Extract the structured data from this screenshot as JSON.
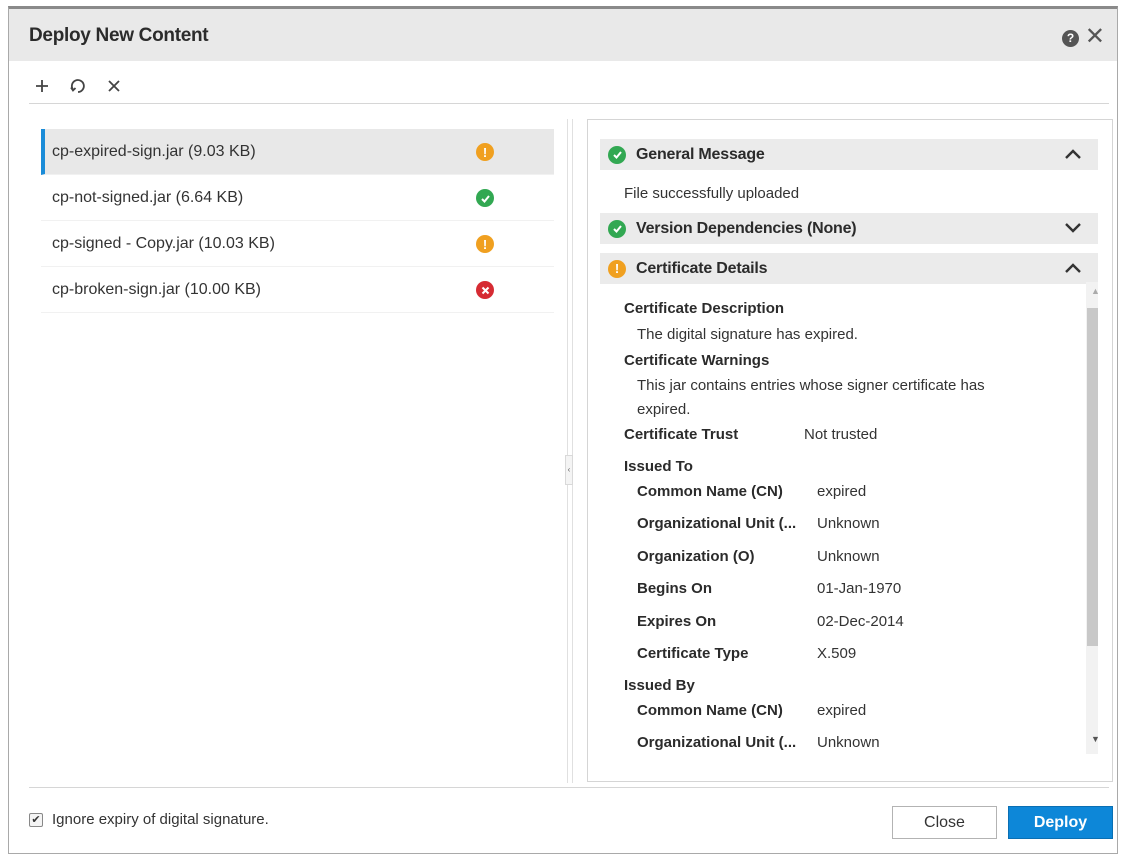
{
  "dialog": {
    "title": "Deploy New Content",
    "help_label": "?",
    "close_glyph": "✕"
  },
  "toolbar": {
    "add_icon": "plus-icon",
    "refresh_icon": "refresh-icon",
    "remove_icon": "close-icon"
  },
  "files": [
    {
      "label": "cp-expired-sign.jar (9.03 KB)",
      "status": "warning",
      "selected": true
    },
    {
      "label": "cp-not-signed.jar (6.64 KB)",
      "status": "success",
      "selected": false
    },
    {
      "label": "cp-signed - Copy.jar (10.03 KB)",
      "status": "warning",
      "selected": false
    },
    {
      "label": "cp-broken-sign.jar (10.00 KB)",
      "status": "error",
      "selected": false
    }
  ],
  "status_glyphs": {
    "warning": "!",
    "success": "✓",
    "error": "✕"
  },
  "colors": {
    "warning": "#f0a020",
    "success": "#32a852",
    "error": "#d62b33",
    "accent": "#0d87d8",
    "selection_bar": "#1a8cd8"
  },
  "details": {
    "general": {
      "title": "General Message",
      "text": "File successfully uploaded",
      "status": "success",
      "expanded": true
    },
    "version": {
      "title": "Version Dependencies (None)",
      "status": "success",
      "expanded": false
    },
    "certificate": {
      "title": "Certificate Details",
      "status": "warning",
      "expanded": true,
      "description_label": "Certificate Description",
      "description_text": "The digital signature has expired.",
      "warnings_label": "Certificate Warnings",
      "warnings_text_1": "This jar contains entries whose signer certificate has",
      "warnings_text_2": "expired.",
      "trust_label": "Certificate Trust",
      "trust_value": "Not trusted",
      "issued_to_label": "Issued To",
      "issued_to": [
        {
          "label": "Common Name (CN)",
          "value": "expired"
        },
        {
          "label": "Organizational Unit (...",
          "value": "Unknown"
        },
        {
          "label": "Organization (O)",
          "value": "Unknown"
        },
        {
          "label": "Begins On",
          "value": "01-Jan-1970"
        },
        {
          "label": "Expires On",
          "value": "02-Dec-2014"
        },
        {
          "label": "Certificate Type",
          "value": "X.509"
        }
      ],
      "issued_by_label": "Issued By",
      "issued_by": [
        {
          "label": "Common Name (CN)",
          "value": "expired"
        },
        {
          "label": "Organizational Unit (...",
          "value": "Unknown"
        }
      ]
    }
  },
  "footer": {
    "ignore_label": "Ignore expiry of digital signature.",
    "ignore_checked": true,
    "close_label": "Close",
    "deploy_label": "Deploy"
  }
}
